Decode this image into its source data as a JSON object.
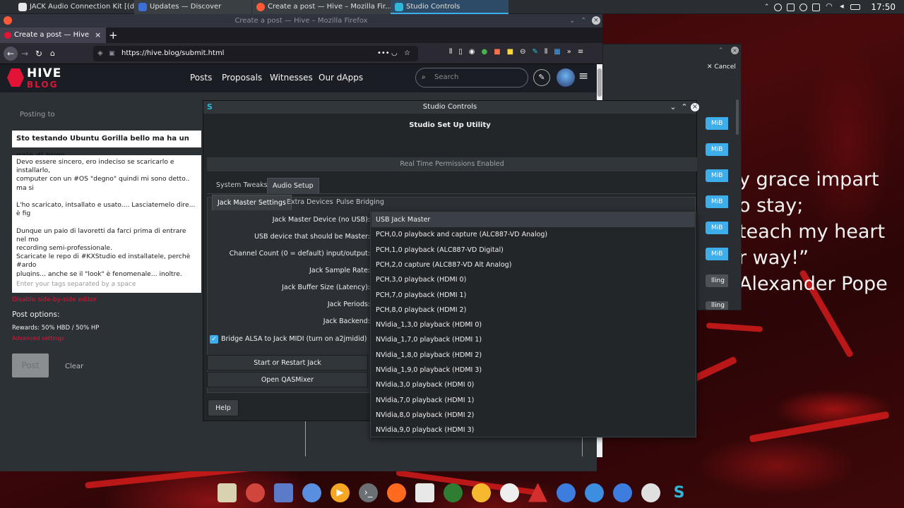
{
  "taskbar": {
    "tasks": [
      {
        "title": "JACK Audio Connection Kit [(defau...",
        "color": "#e8e8e8"
      },
      {
        "title": "Updates — Discover",
        "color": "#3d6fd6"
      },
      {
        "title": "Create a post — Hive – Mozilla Fir...",
        "color": "#ff5a36"
      },
      {
        "title": "Studio Controls",
        "color": "#2fb6d8"
      }
    ],
    "clock": "17:50"
  },
  "wallpaper": {
    "quote": "y grace impart\no stay;\nteach my heart\nr way!”\nAlexander Pope"
  },
  "firefox": {
    "window_title": "Create a post — Hive – Mozilla Firefox",
    "tab_title": "Create a post — Hive",
    "new_tab": "+",
    "url": "https://hive.blog/submit.html"
  },
  "hive": {
    "logo_top": "HIVE",
    "logo_bottom": "BLOG",
    "nav": [
      "Posts",
      "Proposals",
      "Witnesses",
      "Our dApps"
    ],
    "search_placeholder": "Search",
    "posting_to": "Posting to",
    "post_title": "Sto testando Ubuntu Gorilla bello ma ha un paio di bugs",
    "post_body": "Devo essere sincero, ero indeciso se scaricarlo e installarlo,\ncomputer con un #OS \"degno\" quindi mi sono detto.. ma si\n\nL'ho scaricato, intsallato e usato.... Lasciatemelo dire...  è fig\n\nDunque un paio di lavoretti da farci prima di entrare nel mo\nrecording semi-professionale.\nScaricate le repo di #KXStudio ed installatele, perchè #ardo\nplugins... anche se il \"look\" è fenomenale... inoltre.\nFat eattenzione a sistemare l'audio plugin da Studio Contro\n\n\nInsert images by dragging & dropping, pasting from the clipboard, or b",
    "tags_placeholder": "Enter your tags separated by a space",
    "disable_editor": "Disable side-by-side editor",
    "post_options": "Post options:",
    "rewards": "Rewards: 50% HBD / 50% HP",
    "advanced": "Advanced settings",
    "post_btn": "Post",
    "clear_btn": "Clear"
  },
  "right_window": {
    "cancel": "Cancel",
    "mib_labels": [
      "MiB",
      "MiB",
      "MiB",
      "MiB",
      "MiB",
      "MiB"
    ],
    "other": [
      "lling",
      "lling"
    ]
  },
  "studio": {
    "title": "Studio Controls",
    "heading": "Studio Set Up Utility",
    "rt_banner": "Real Time Permissions Enabled",
    "tabs": [
      "System Tweaks",
      "Audio Setup"
    ],
    "subtabs": [
      "Jack Master Settings",
      "Extra Devices",
      "Pulse Bridging"
    ],
    "labels": [
      "Jack Master Device (no USB):",
      "USB device that should be Master:",
      "Channel Count (0 = default) input/output:",
      "Jack Sample Rate:",
      "Jack Buffer Size (Latency):",
      "Jack Periods:",
      "Jack Backend:"
    ],
    "bridge_check": "Bridge ALSA to Jack MIDI (turn on a2jmidid)",
    "start_btn": "Start or Restart  Jack",
    "qas_btn": "Open QASMixer",
    "help_btn": "Help"
  },
  "dropdown": {
    "selected": "USB Jack Master",
    "items": [
      "USB Jack Master",
      "PCH,0,0 playback and capture (ALC887-VD Analog)",
      "PCH,1,0 playback (ALC887-VD Digital)",
      "PCH,2,0 capture (ALC887-VD Alt Analog)",
      "PCH,3,0 playback (HDMI 0)",
      "PCH,7,0 playback (HDMI 1)",
      "PCH,8,0 playback (HDMI 2)",
      "NVidia_1,3,0 playback (HDMI 0)",
      "NVidia_1,7,0 playback (HDMI 1)",
      "NVidia_1,8,0 playback (HDMI 2)",
      "NVidia_1,9,0 playback (HDMI 3)",
      "NVidia,3,0 playback (HDMI 0)",
      "NVidia,7,0 playback (HDMI 1)",
      "NVidia,8,0 playback (HDMI 2)",
      "NVidia,9,0 playback (HDMI 3)"
    ]
  },
  "dock": {
    "icons": [
      {
        "name": "brush-icon",
        "color": "#d9d2b0"
      },
      {
        "name": "book-icon",
        "color": "#d0463c"
      },
      {
        "name": "paint-icon",
        "color": "#5b7bc8"
      },
      {
        "name": "discord-icon",
        "color": "#5a8fe0"
      },
      {
        "name": "media-icon",
        "color": "#f5a623"
      },
      {
        "name": "terminal-icon",
        "color": "#6b7075"
      },
      {
        "name": "firefox-icon",
        "color": "#ff6a1f"
      },
      {
        "name": "photos-icon",
        "color": "#e8e8e8"
      },
      {
        "name": "globe-icon",
        "color": "#2e7d32"
      },
      {
        "name": "moon-icon",
        "color": "#f5b82e"
      },
      {
        "name": "pen-icon",
        "color": "#eeeeee"
      },
      {
        "name": "triangle-icon",
        "color": "#d32f2f"
      },
      {
        "name": "store-icon",
        "color": "#3d7de0"
      },
      {
        "name": "folder-icon",
        "color": "#3d8de0"
      },
      {
        "name": "bag-icon",
        "color": "#3d7de0"
      },
      {
        "name": "obs-icon",
        "color": "#e0e0e0"
      },
      {
        "name": "studio-icon",
        "color": "#2fb6d8"
      }
    ]
  }
}
